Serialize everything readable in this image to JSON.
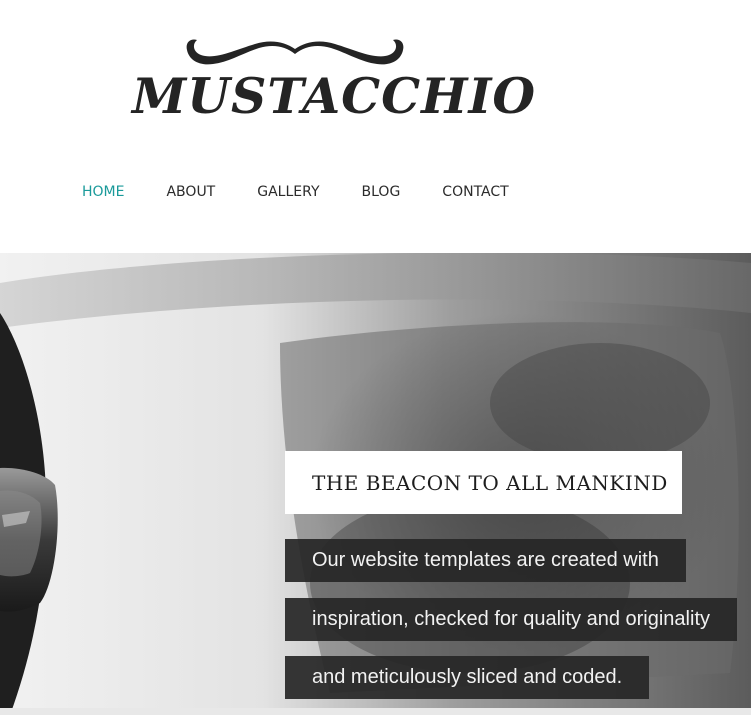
{
  "brand": {
    "name": "MUSTACCHIO"
  },
  "nav": {
    "items": [
      {
        "label": "HOME",
        "active": true
      },
      {
        "label": "ABOUT",
        "active": false
      },
      {
        "label": "GALLERY",
        "active": false
      },
      {
        "label": "BLOG",
        "active": false
      },
      {
        "label": "CONTACT",
        "active": false
      }
    ]
  },
  "hero": {
    "headline": "THE BEACON TO ALL MANKIND",
    "lines": [
      "Our website templates are created with",
      "inspiration, checked for quality and originality",
      "and meticulously sliced and coded."
    ]
  },
  "colors": {
    "accent": "#1a9a9a",
    "text": "#2b2b2b",
    "logo": "#242424",
    "caption_bg": "#262626",
    "caption_text": "#f2f2f2"
  },
  "icons": {
    "logo_mark": "mustache-icon"
  }
}
